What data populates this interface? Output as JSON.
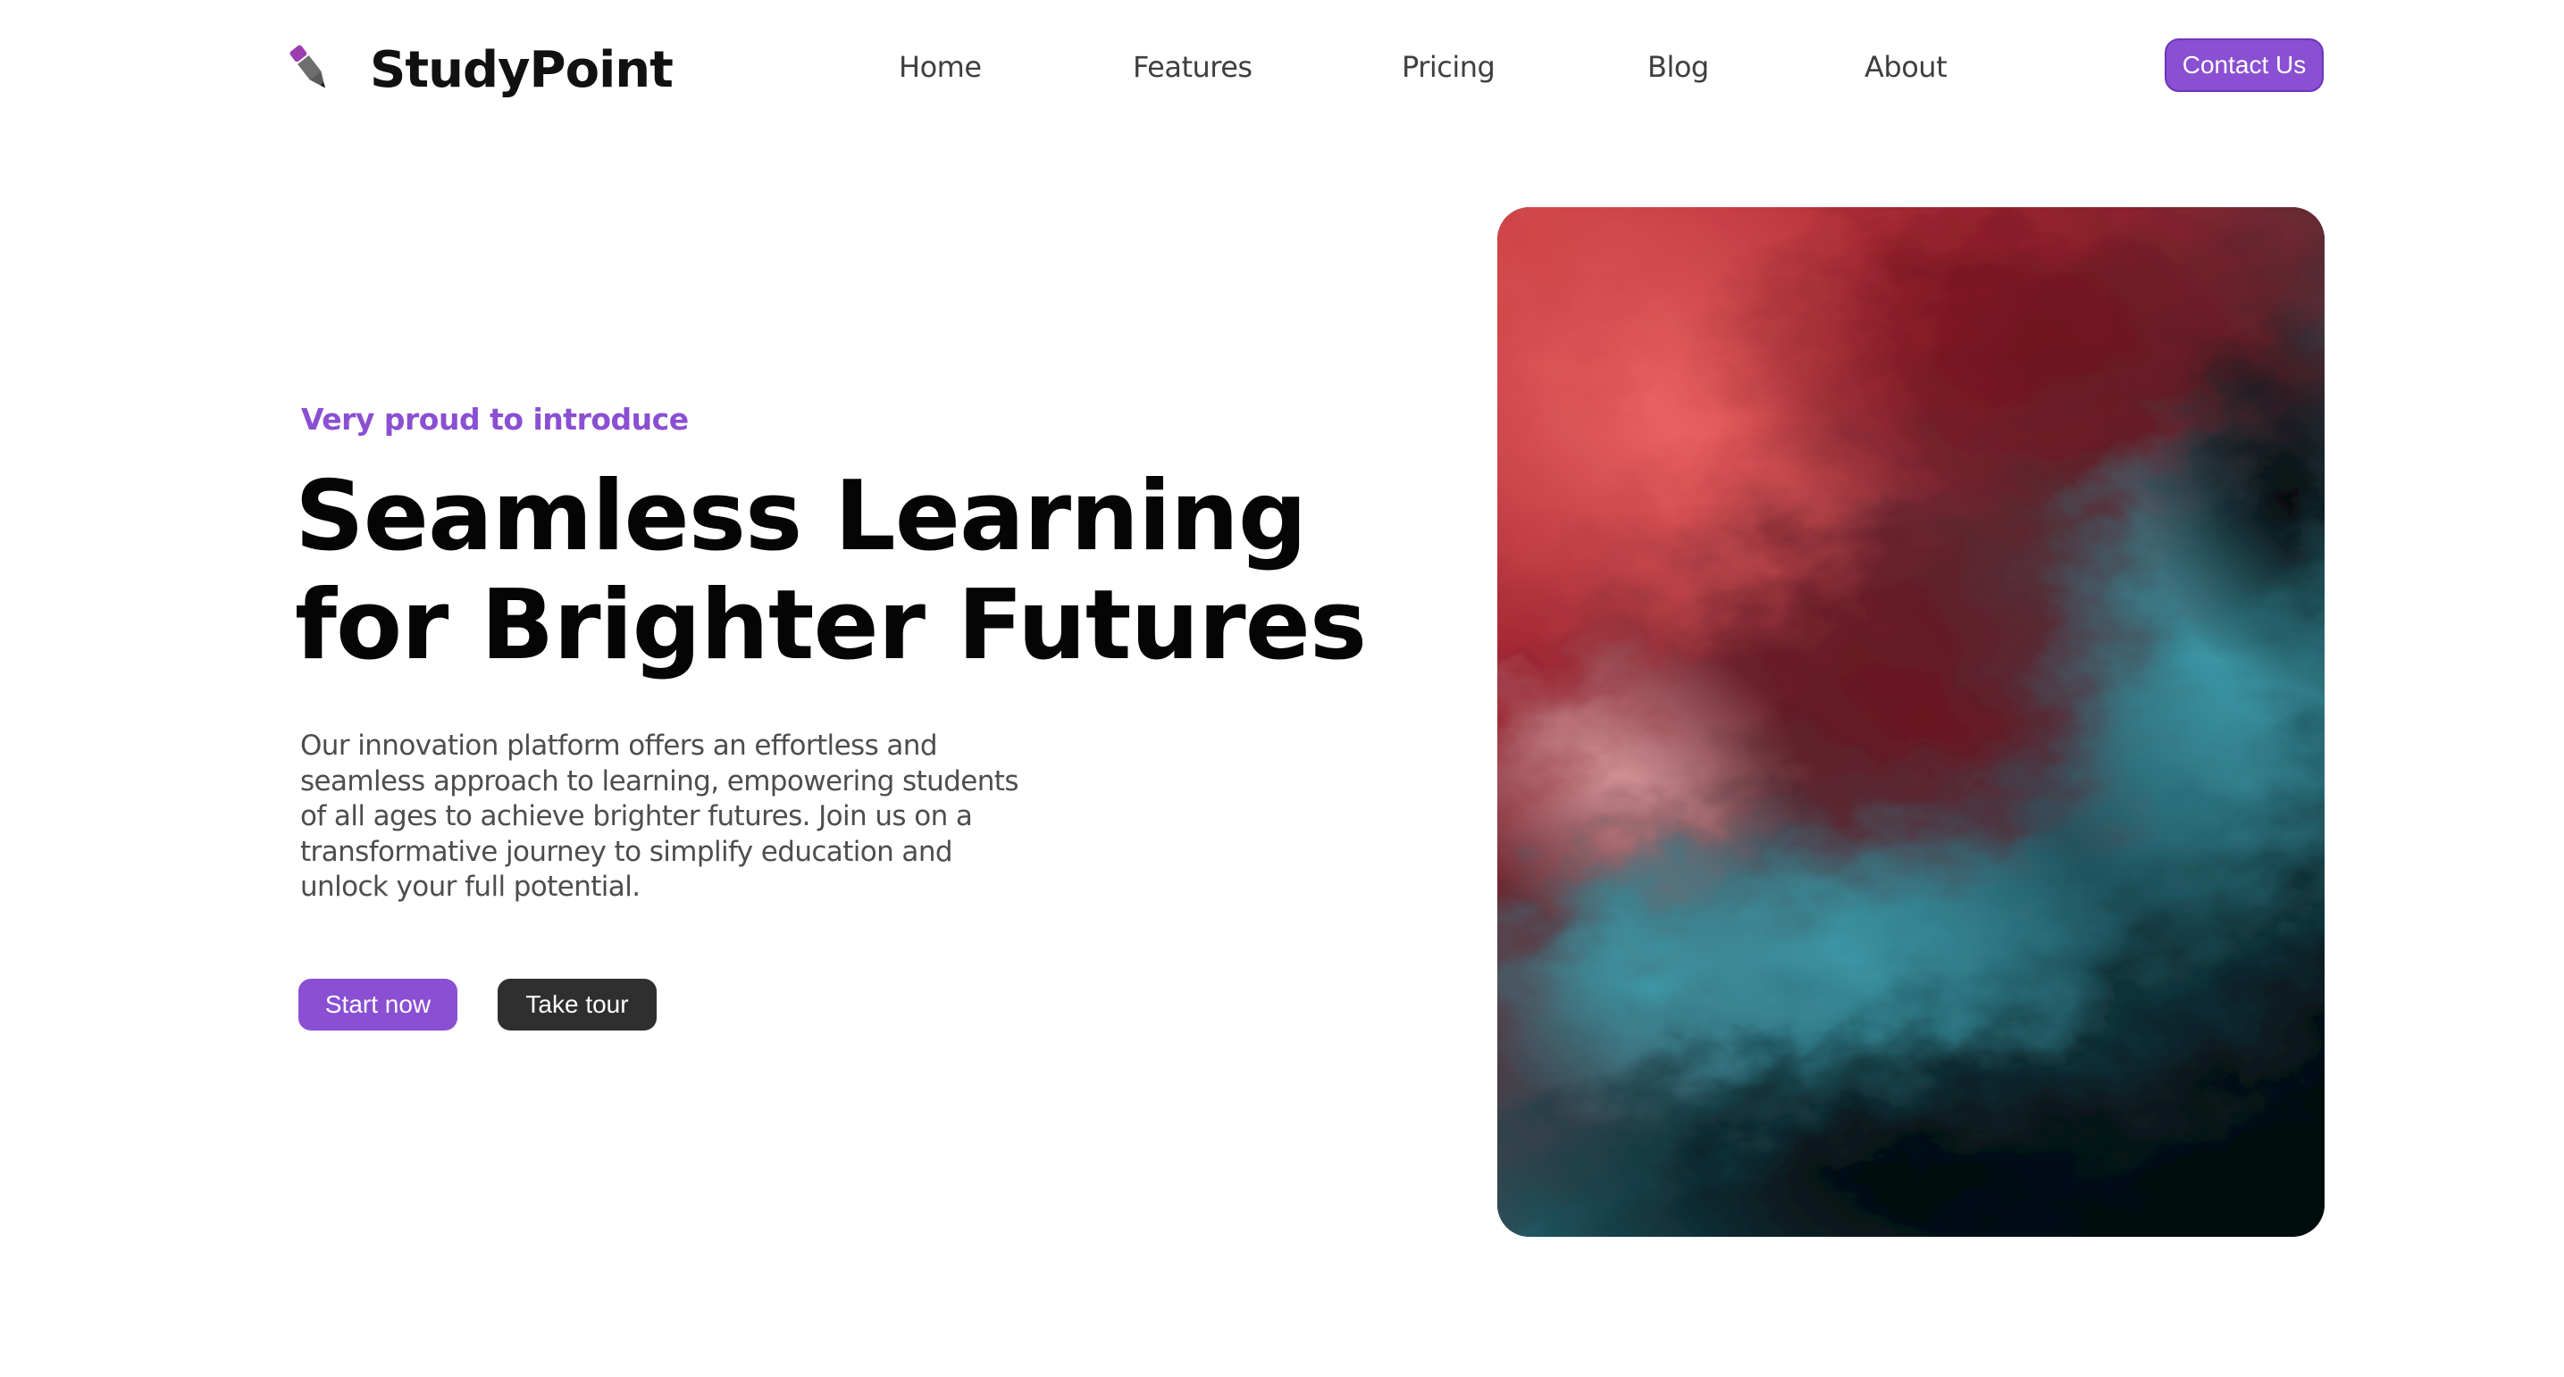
{
  "brand": {
    "name": "StudyPoint",
    "icon": "pencil-icon",
    "accent_color": "#8a4fd2"
  },
  "nav": {
    "items": [
      {
        "label": "Home"
      },
      {
        "label": "Features"
      },
      {
        "label": "Pricing"
      },
      {
        "label": "Blog"
      },
      {
        "label": "About"
      }
    ],
    "contact_label": "Contact Us"
  },
  "hero": {
    "eyebrow": "Very proud to introduce",
    "headline_line1": "Seamless Learning",
    "headline_line2": "for Brighter Futures",
    "description": "Our innovation platform offers an effortless and seamless approach to learning, empowering students of all ages to achieve brighter futures. Join us on a transformative journey to simplify education and unlock your full potential.",
    "primary_cta": "Start now",
    "secondary_cta": "Take tour",
    "image": "abstract-red-teal-fluid-art"
  },
  "colors": {
    "primary": "#8a4fd2",
    "dark_button": "#2f2f2f",
    "heading": "#050505",
    "body_text": "#4d4d4d",
    "image_red": "#c8373c",
    "image_teal": "#2f7f8c"
  }
}
